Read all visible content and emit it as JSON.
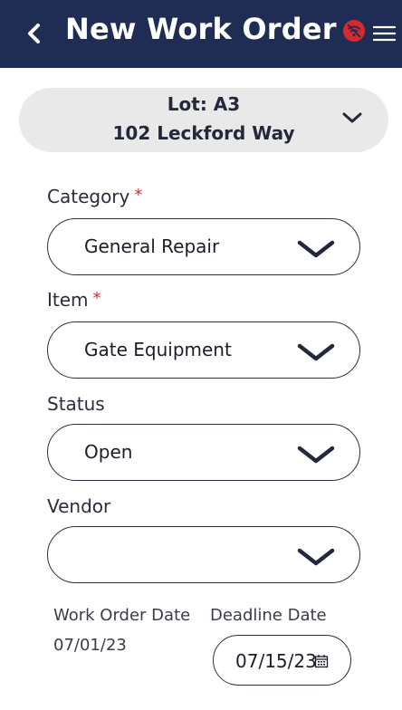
{
  "header": {
    "title": "New Work Order",
    "back_icon": "chevron-left-icon",
    "status_icon": "wifi-off-icon",
    "menu_icon": "hamburger-menu-icon",
    "background": "#1f2d55"
  },
  "lot": {
    "lot_line": "Lot: A3",
    "address": "102 Leckford Way",
    "icon": "chevron-down-icon"
  },
  "form": {
    "category": {
      "label": "Category",
      "required_mark": "*",
      "value": "General Repair"
    },
    "item": {
      "label": "Item",
      "required_mark": "*",
      "value": "Gate Equipment"
    },
    "status": {
      "label": "Status",
      "value": "Open"
    },
    "vendor": {
      "label": "Vendor",
      "value": ""
    },
    "work_order_date": {
      "label": "Work Order Date",
      "value": "07/01/23"
    },
    "deadline_date": {
      "label": "Deadline Date",
      "value": "07/15/23",
      "icon": "calendar-icon"
    }
  },
  "colors": {
    "required": "#d8292f",
    "offline_status": "#d8292f",
    "card_background": "#e9e9ea"
  }
}
